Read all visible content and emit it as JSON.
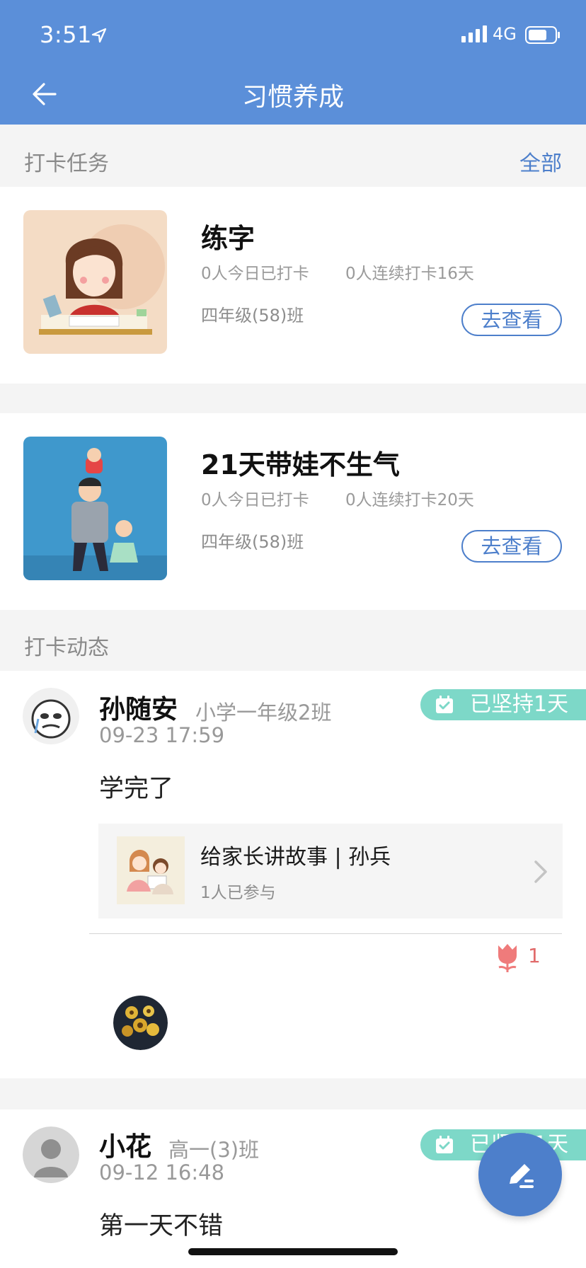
{
  "status": {
    "time": "3:51",
    "network": "4G"
  },
  "header": {
    "title": "习惯养成"
  },
  "tasks_section": {
    "label": "打卡任务",
    "all_link": "全部"
  },
  "tasks": [
    {
      "title": "练字",
      "today_checked": "0人今日已打卡",
      "streak": "0人连续打卡16天",
      "class_name": "四年级(58)班",
      "view_button": "去查看"
    },
    {
      "title": "21天带娃不生气",
      "today_checked": "0人今日已打卡",
      "streak": "0人连续打卡20天",
      "class_name": "四年级(58)班",
      "view_button": "去查看"
    }
  ],
  "feed_section": {
    "label": "打卡动态"
  },
  "posts": [
    {
      "user": "孙随安",
      "class_name": "小学一年级2班",
      "time": "09-23    17:59",
      "badge": "已坚持1天",
      "text": "学完了",
      "story": {
        "title": "给家长讲故事 | 孙兵",
        "participants": "1人已参与"
      },
      "likes": "1"
    },
    {
      "user": "小花",
      "class_name": "高一(3)班",
      "time": "09-12    16:48",
      "badge": "已坚持1天",
      "text": "第一天不错"
    }
  ],
  "colors": {
    "primary": "#5b8fd9",
    "accent": "#4d7fcb",
    "badge": "#7dd8c8",
    "like": "#e16b6b"
  }
}
